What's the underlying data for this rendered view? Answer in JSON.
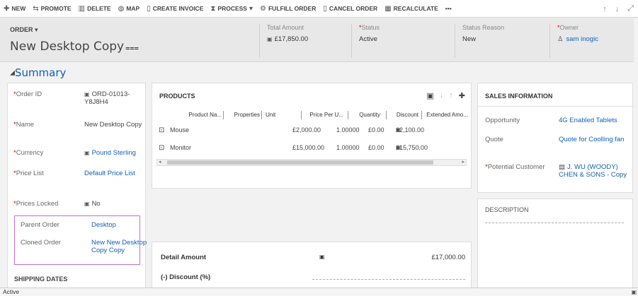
{
  "toolbar": {
    "new": "NEW",
    "promote": "PROMOTE",
    "delete": "DELETE",
    "map": "MAP",
    "create_invoice": "CREATE INVOICE",
    "process": "PROCESS",
    "fulfill_order": "FULFILL ORDER",
    "cancel_order": "CANCEL ORDER",
    "recalculate": "RECALCULATE",
    "more": "•••",
    "up": "↑",
    "down": "↓"
  },
  "header": {
    "entity": "ORDER ▾",
    "title": "New Desktop Copy",
    "total_amount_label": "Total Amount",
    "total_amount_value": "£17,850.00",
    "status_label": "Status",
    "status_value": "Active",
    "status_reason_label": "Status Reason",
    "status_reason_value": "New",
    "owner_label": "Owner",
    "owner_value": "sam inogic"
  },
  "summary": {
    "title": "Summary",
    "fields": {
      "order_id_label": "Order ID",
      "order_id_value": "ORD-01013-Y8J8H4",
      "name_label": "Name",
      "name_value": "New Desktop Copy",
      "currency_label": "Currency",
      "currency_value": "Pound Sterling",
      "price_list_label": "Price List",
      "price_list_value": "Default Price List",
      "prices_locked_label": "Prices Locked",
      "prices_locked_value": "No",
      "parent_order_label": "Parent Order",
      "parent_order_value": "Desktop",
      "cloned_order_label": "Cloned Order",
      "cloned_order_value": "New New Desktop Copy Copy"
    },
    "shipping_title": "SHIPPING DATES"
  },
  "products": {
    "title": "PRODUCTS",
    "columns": [
      "Product Na...",
      "Properties",
      "Unit",
      "Price Per U...",
      "Quantity",
      "Discount",
      "Extended Amo..."
    ],
    "rows": [
      {
        "name": "Mouse",
        "price": "£2,000.00",
        "quantity": "1.00000",
        "discount": "£0.00",
        "extended": "£2,100.00"
      },
      {
        "name": "Monitor",
        "price": "£15,000.00",
        "quantity": "1.00000",
        "discount": "£0.00",
        "extended": "£15,750.00"
      }
    ]
  },
  "totals": {
    "detail_amount_label": "Detail Amount",
    "detail_amount_value": "£17,000.00",
    "discount_label": "(-) Discount (%)"
  },
  "sales": {
    "title": "SALES INFORMATION",
    "opportunity_label": "Opportunity",
    "opportunity_value": "4G Enabled Tablets",
    "quote_label": "Quote",
    "quote_value": "Quote for Coolling fan",
    "potential_customer_label": "Potential Customer",
    "potential_customer_value": "J. WU (WOODY) CHEN & SONS - Copy"
  },
  "description": {
    "title": "DESCRIPTION"
  },
  "status_bar": {
    "status": "Active"
  }
}
